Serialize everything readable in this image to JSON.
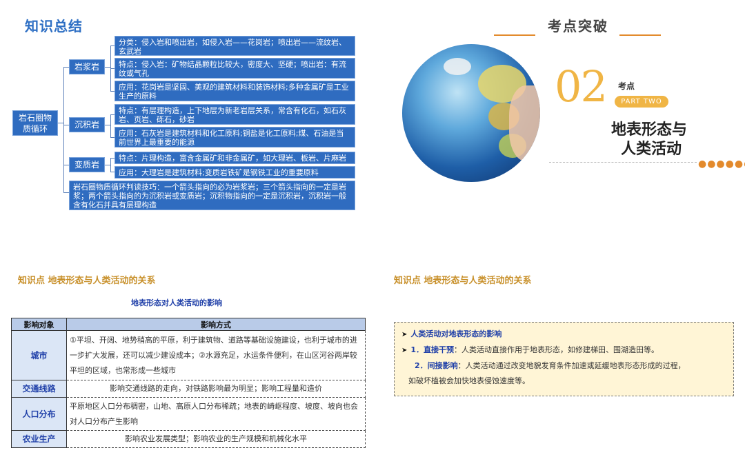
{
  "summary": {
    "title": "知识总结",
    "root": "岩石圈物质循环",
    "branches": {
      "igneous": {
        "label": "岩浆岩",
        "classification": "分类：侵入岩和喷出岩，如侵入岩——花岗岩；喷出岩——流纹岩、玄武岩",
        "features": "特点：侵入岩：矿物结晶颗粒比较大，密度大、坚硬；喷出岩：有流纹或气孔",
        "application": "应用：花岗岩是坚固、美观的建筑材料和装饰材料;多种金属矿是工业生产的原料"
      },
      "sedimentary": {
        "label": "沉积岩",
        "features": "特点：有层理构造，上下地层为新老岩层关系，常含有化石，如石灰岩、页岩、砾石，砂岩",
        "application": "应用：石灰岩是建筑材料和化工原料;铜盐是化工原料;煤、石油是当前世界上最重要的能源"
      },
      "metamorphic": {
        "label": "变质岩",
        "features": "特点：片理构造，富含金属矿和非金属矿，如大理岩、板岩、片麻岩",
        "application": "应用：大理岩是建筑材料;变质岩铁矿是钢铁工业的重要原料"
      }
    },
    "tip": "岩石圈物质循环判读技巧：一个箭头指向的必为岩浆岩；三个箭头指向的一定是岩浆；两个箭头指向的为沉积岩或变质岩；沉积物指向的一定是沉积岩，沉积岩一般含有化石并具有层理构造"
  },
  "cover": {
    "heading": "考点突破",
    "number": "02",
    "label": "考点",
    "part": "PART TWO",
    "title_line1": "地表形态与",
    "title_line2": "人类活动",
    "dots": "●●●●●●"
  },
  "knowledge_point": {
    "left_heading": "知识点  地表形态与人类活动的关系",
    "right_heading": "知识点  地表形态与人类活动的关系",
    "table_title": "地表形态对人类活动的影响",
    "table_headers": [
      "影响对象",
      "影响方式"
    ],
    "rows": [
      {
        "object": "城市",
        "method": "①平坦、开阔、地势稍高的平原，利于建筑物、道路等基础设施建设，也利于城市的进一步扩大发展，还可以减少建设成本；②水源充足，水运条件便利，在山区河谷两岸较平坦的区域，也常形成一些城市"
      },
      {
        "object": "交通线路",
        "method": "影响交通线路的走向，对铁路影响最为明显；影响工程量和造价"
      },
      {
        "object": "人口分布",
        "method": "平原地区人口分布稠密，山地、高原人口分布稀疏；地表的崎岖程度、坡度、坡向也会对人口分布产生影响"
      },
      {
        "object": "农业生产",
        "method": "影响农业发展类型；影响农业的生产规模和机械化水平"
      }
    ]
  },
  "explanation": {
    "heading": "人类活动对地表形态的影响",
    "item1_key": "1．直接干预",
    "item1_text": "：人类活动直接作用于地表形态，如修建梯田、围湖造田等。",
    "item2_key": "2．间接影响",
    "item2_text": "：人类活动通过改变地貌发育条件加速或延缓地表形态形成的过程，",
    "item2_text_cont": "如破坏植被会加快地表侵蚀速度等。"
  },
  "colors": {
    "accent_blue": "#2f6cc0",
    "heading_gold": "#c8902a",
    "cover_orange": "#f0b545",
    "box_fill": "#fff5d6"
  }
}
